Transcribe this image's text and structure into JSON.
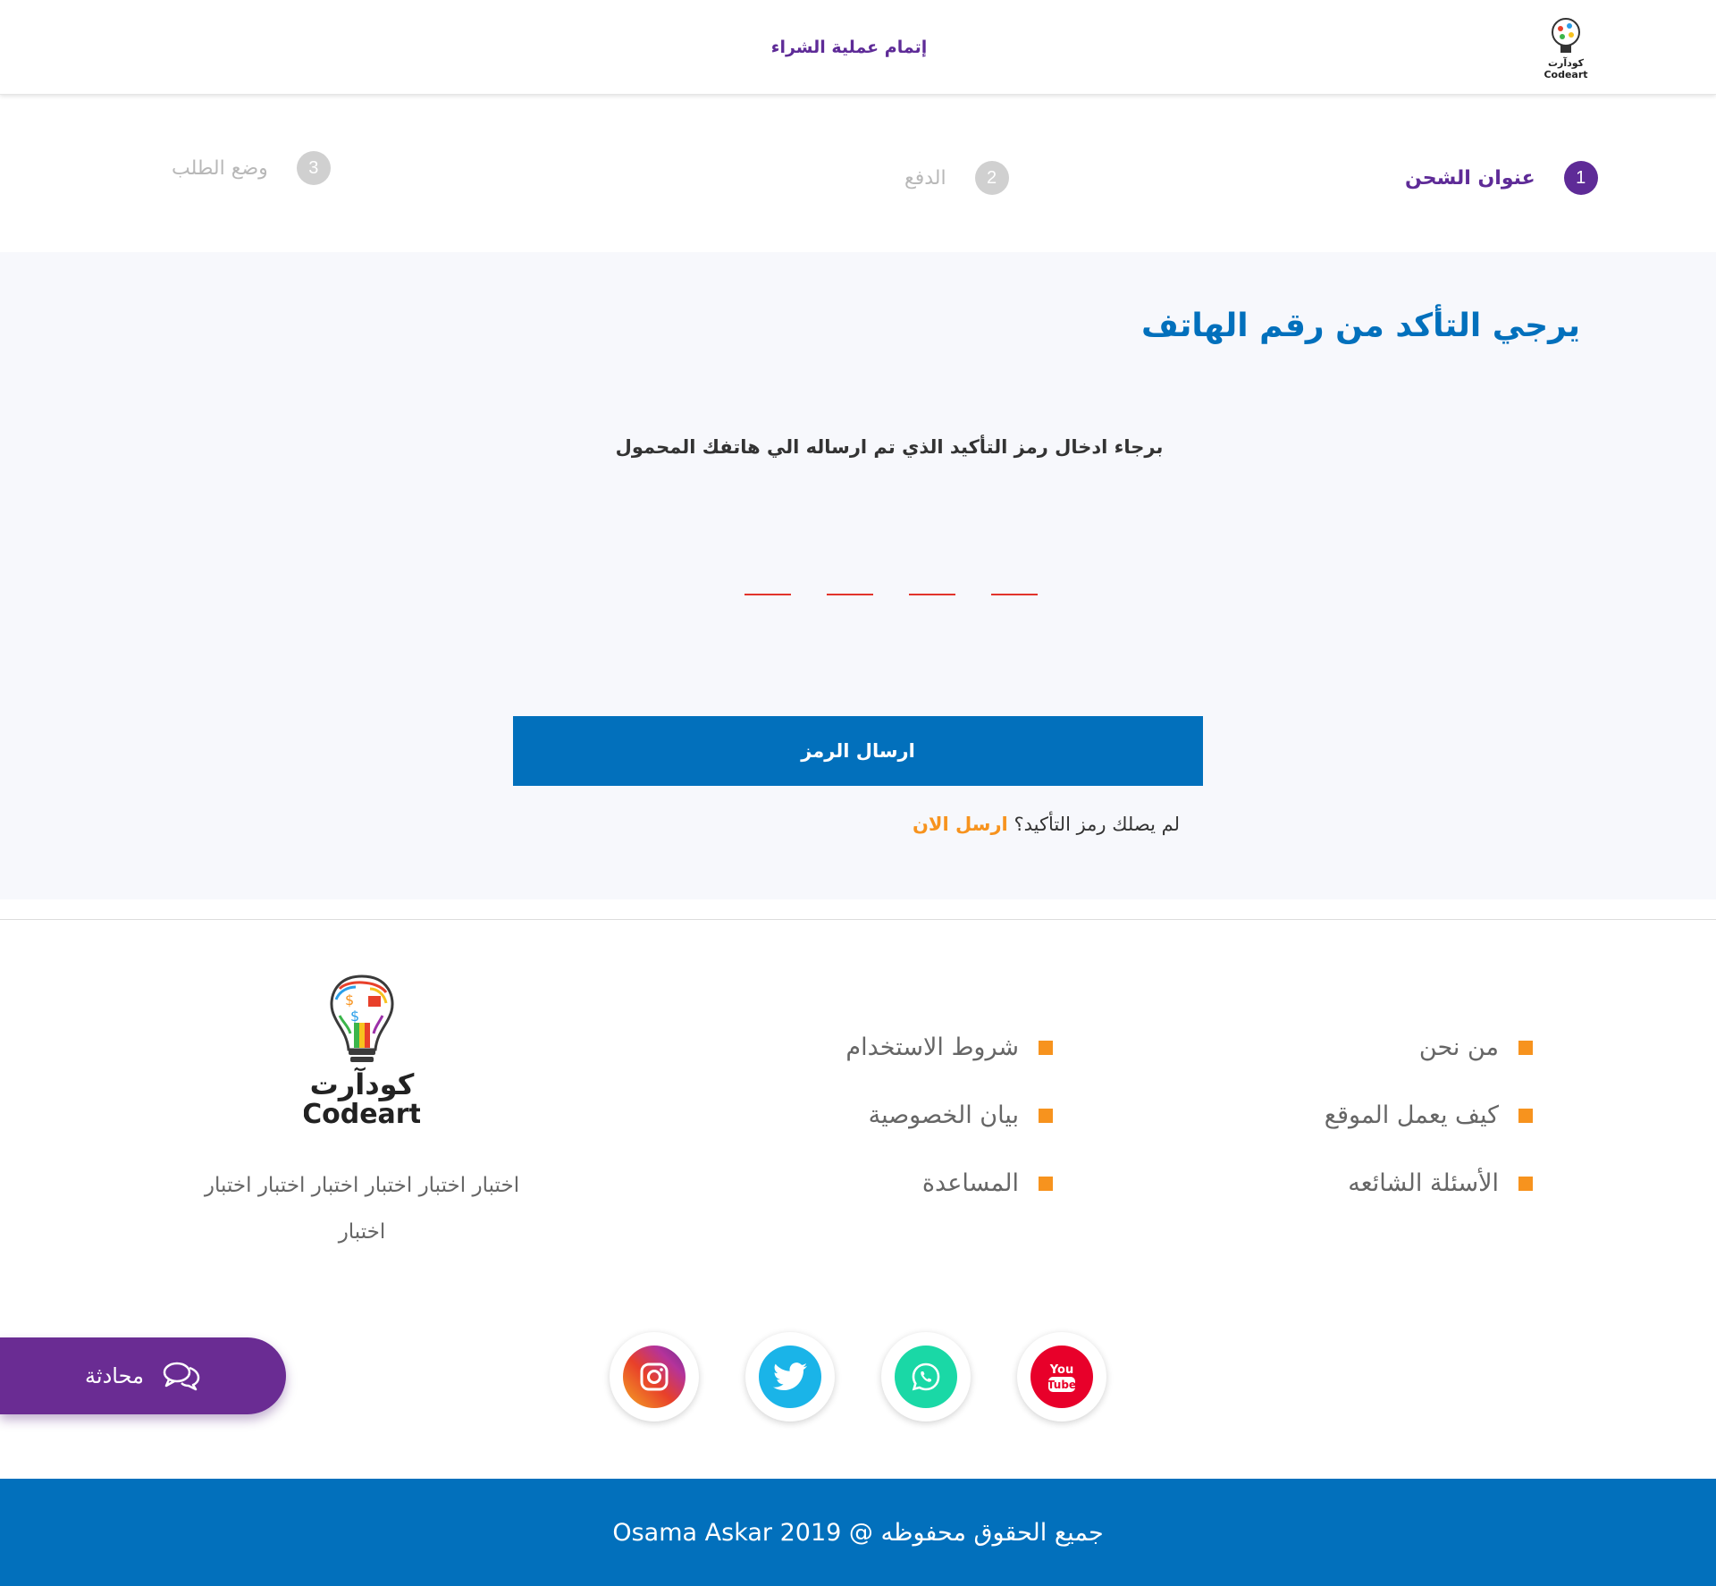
{
  "header": {
    "title": "إتمام عملية الشراء",
    "logo_text": "كودآرت Codeart"
  },
  "stepper": [
    {
      "num": "1",
      "label": "عنوان الشحن",
      "state": "active"
    },
    {
      "num": "2",
      "label": "الدفع",
      "state": "inactive"
    },
    {
      "num": "3",
      "label": "وضع الطلب",
      "state": "inactive"
    }
  ],
  "main": {
    "title": "يرجي التأكد من رقم الهاتف",
    "instruction": "برجاء ادخال رمز التأكيد الذي تم ارساله الي هاتفك المحمول",
    "otp_digits": [
      "",
      "",
      "",
      ""
    ],
    "submit_label": "ارسال الرمز",
    "resend_question": "لم يصلك رمز التأكيد؟",
    "resend_link": "ارسل الان"
  },
  "footer": {
    "logo_arabic": "كودآرت",
    "logo_latin": "Codeart",
    "description": "اختبار اختبار اختبار اختبار اختبار اختبار اختبار",
    "links_col1": [
      "من نحن",
      "كيف يعمل الموقع",
      "الأسئلة الشائعه"
    ],
    "links_col2": [
      "شروط الاستخدام",
      "بيان الخصوصية",
      "المساعدة"
    ],
    "social": [
      {
        "name": "youtube",
        "icon": "youtube-icon",
        "color": "#e8002a"
      },
      {
        "name": "whatsapp",
        "icon": "whatsapp-icon",
        "color": "#1ad8a6"
      },
      {
        "name": "twitter",
        "icon": "twitter-icon",
        "color": "#1ab4e8"
      },
      {
        "name": "instagram",
        "icon": "instagram-icon",
        "color": "#b5339a"
      }
    ],
    "chat_label": "محادثة",
    "copyright": "جميع الحقوق محفوظه @ 2019  Osama Askar"
  },
  "colors": {
    "brand_purple": "#5e2b97",
    "brand_blue": "#0270bc",
    "accent_orange": "#f7931e",
    "otp_underline": "#e2342b"
  }
}
